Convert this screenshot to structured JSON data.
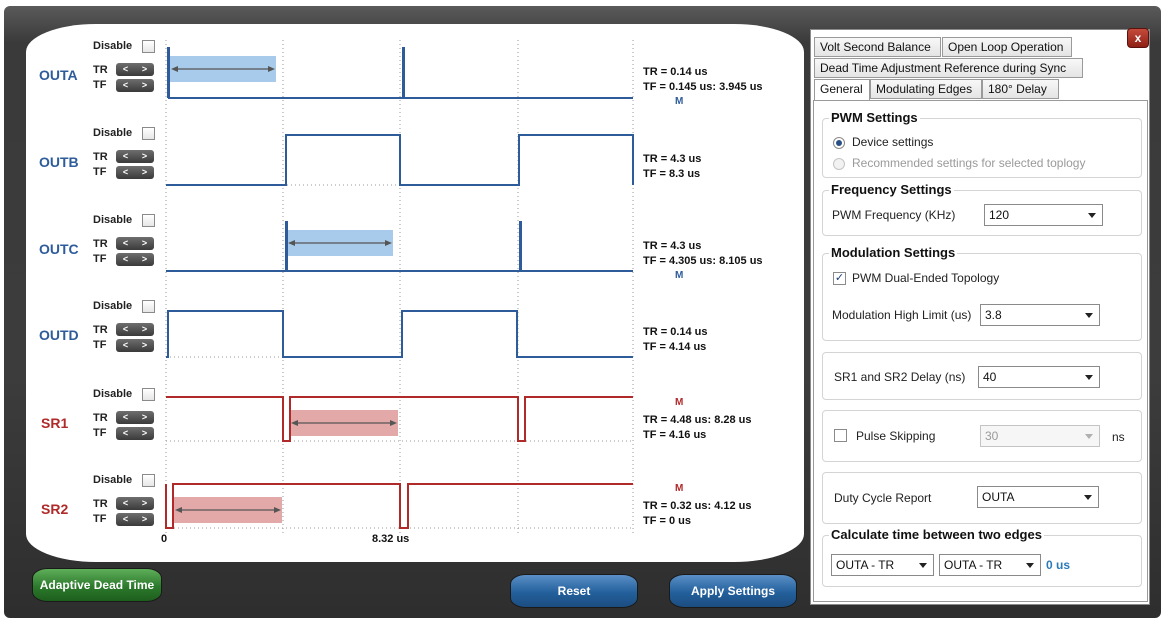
{
  "disable_label": "Disable",
  "tr_label": "TR",
  "tf_label": "TF",
  "nav_prev": "<",
  "nav_next": ">",
  "marker_label": "M",
  "channels": [
    {
      "name": "OUTA",
      "color": "#2e5c9a",
      "tr_text": "TR = 0.14 us",
      "tf_text": "TF = 0.145 us: 3.945 us",
      "marker_pos": "below"
    },
    {
      "name": "OUTB",
      "color": "#2e5c9a",
      "tr_text": "TR = 4.3 us",
      "tf_text": "TF = 8.3 us",
      "marker_pos": "none"
    },
    {
      "name": "OUTC",
      "color": "#2e5c9a",
      "tr_text": "TR = 4.3 us",
      "tf_text": "TF = 4.305 us: 8.105 us",
      "marker_pos": "below"
    },
    {
      "name": "OUTD",
      "color": "#2e5c9a",
      "tr_text": "TR = 0.14 us",
      "tf_text": "TF = 4.14 us",
      "marker_pos": "none"
    },
    {
      "name": "SR1",
      "color": "#b02a2a",
      "tr_text": "TR = 4.48 us: 8.28 us",
      "tf_text": "TF = 4.16 us",
      "marker_pos": "above"
    },
    {
      "name": "SR2",
      "color": "#b02a2a",
      "tr_text": "TR = 0.32 us: 4.12 us",
      "tf_text": "TF = 0 us",
      "marker_pos": "above"
    }
  ],
  "axis": {
    "start_label": "0",
    "period_label": "8.32 us"
  },
  "buttons": {
    "adaptive_dead_time": "Adaptive Dead Time",
    "reset": "Reset",
    "apply_settings": "Apply Settings",
    "close": "x"
  },
  "tabs": {
    "row1": [
      "Volt Second Balance",
      "Open Loop Operation"
    ],
    "row2": [
      "Dead Time Adjustment Reference during Sync"
    ],
    "row3": [
      "General",
      "Modulating Edges",
      "180° Delay"
    ],
    "active": "General"
  },
  "settings": {
    "pwm_title": "PWM Settings",
    "device_settings": "Device settings",
    "recommended_settings": "Recommended settings for selected toplogy",
    "frequency_title": "Frequency Settings",
    "pwm_frequency_label": "PWM Frequency (KHz)",
    "pwm_frequency_value": "120",
    "modulation_title": "Modulation Settings",
    "dual_ended_label": "PWM Dual-Ended Topology",
    "dual_ended_checked": true,
    "mod_high_limit_label": "Modulation High Limit (us)",
    "mod_high_limit_value": "3.8",
    "sr_delay_label": "SR1 and SR2 Delay (ns)",
    "sr_delay_value": "40",
    "pulse_skipping_label": "Pulse Skipping",
    "pulse_skipping_value": "30",
    "pulse_skipping_unit": "ns",
    "duty_cycle_label": "Duty Cycle Report",
    "duty_cycle_value": "OUTA",
    "calc_title": "Calculate time between two edges",
    "edge1_value": "OUTA - TR",
    "edge2_value": "OUTA - TR",
    "edge_result": "0 us"
  },
  "colors": {
    "blue_trace": "#2e5c9a",
    "red_trace": "#b02a2a",
    "blue_highlight": "#a9cbeb",
    "red_highlight": "#e3a8a8",
    "adaptive_button": "#2c7a2c",
    "action_button": "#23609c",
    "close_button": "#b0382b",
    "result_text": "#2a7ab8"
  }
}
